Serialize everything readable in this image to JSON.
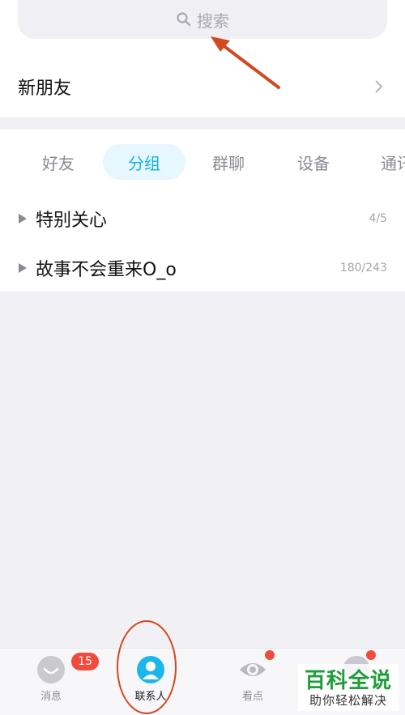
{
  "search": {
    "placeholder": "搜索"
  },
  "new_friend": {
    "label": "新朋友"
  },
  "tabs": [
    {
      "label": "好友",
      "active": false
    },
    {
      "label": "分组",
      "active": true
    },
    {
      "label": "群聊",
      "active": false
    },
    {
      "label": "设备",
      "active": false
    },
    {
      "label": "通讯",
      "active": false
    }
  ],
  "groups": [
    {
      "name": "特别关心",
      "count": "4/5"
    },
    {
      "name": "故事不会重来O_o",
      "count": "180/243"
    }
  ],
  "bottom_nav": {
    "messages": {
      "label": "消息",
      "badge": "15"
    },
    "contacts": {
      "label": "联系人"
    },
    "watch": {
      "label": "看点"
    }
  },
  "watermark": {
    "title": "百科全说",
    "subtitle": "助你轻松解决"
  },
  "colors": {
    "accent": "#14b1e8",
    "badge": "#f14b3c",
    "annotation": "#d2491f",
    "watermark": "#1f9d3a"
  }
}
